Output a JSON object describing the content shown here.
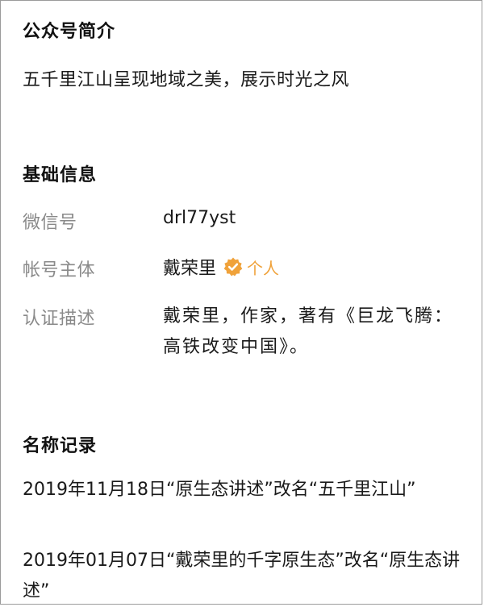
{
  "intro": {
    "title": "公众号简介",
    "text": "五千里江山呈现地域之美，展示时光之风"
  },
  "basic_info": {
    "title": "基础信息",
    "wechat_id_label": "微信号",
    "wechat_id_value": "drl77yst",
    "entity_label": "帐号主体",
    "entity_value": "戴荣里",
    "entity_badge_icon": "verified-check-icon",
    "entity_badge_color": "#f0a23a",
    "entity_badge_text": "个人",
    "cert_label": "认证描述",
    "cert_value": "戴荣里，作家，著有《巨龙飞腾：高铁改变中国》。"
  },
  "name_history": {
    "title": "名称记录",
    "records": [
      "2019年11月18日“原生态讲述”改名“五千里江山”",
      "2019年01月07日“戴荣里的千字原生态”改名“原生态讲述”"
    ]
  }
}
